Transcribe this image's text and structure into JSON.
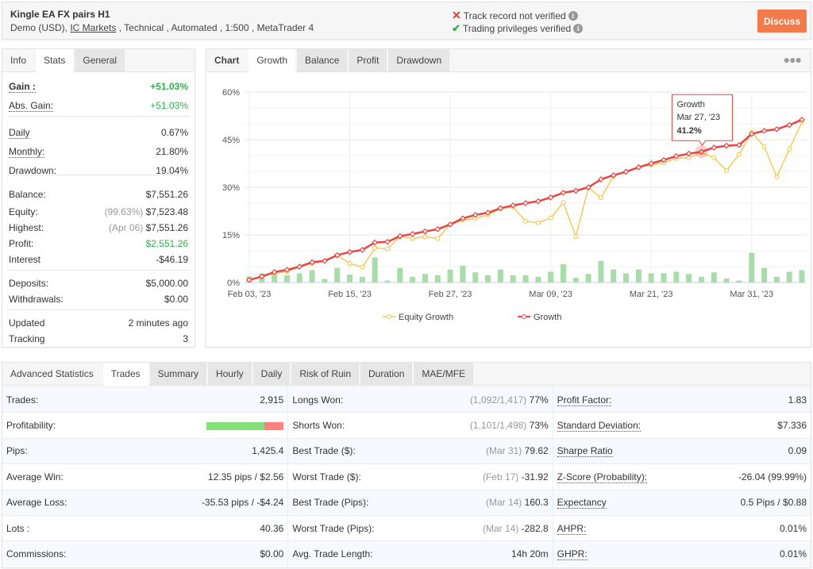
{
  "header": {
    "title": "Kingle EA FX pairs H1",
    "sub_prefix": "Demo (USD), ",
    "broker": "IC Markets",
    "sub_suffix": " , Technical , Automated , 1:500 , MetaTrader 4",
    "verify": [
      {
        "icon": "x-icon",
        "text": "Track record not verified",
        "color": "#e53935"
      },
      {
        "icon": "check-icon",
        "text": "Trading privileges verified",
        "color": "#2db24a"
      }
    ],
    "discuss": "Discuss"
  },
  "left": {
    "tabs": [
      "Info",
      "Stats",
      "General"
    ],
    "active": "Stats",
    "rows": [
      {
        "k": "Gain :",
        "v": "+51.03%",
        "style": "green bold"
      },
      {
        "k": "Abs. Gain:",
        "v": "+51.03%",
        "style": "green"
      },
      {
        "k": "Daily",
        "v": "0.67%"
      },
      {
        "k": "Monthly:",
        "v": "21.80%"
      },
      {
        "k": "Drawdown:",
        "v": "19.04%"
      },
      {
        "k": "Balance:",
        "v": "$7,551.26"
      },
      {
        "k": "Equity:",
        "pre": "(99.63%)",
        "v": "$7,523.48"
      },
      {
        "k": "Highest:",
        "pre": "(Apr 06)",
        "v": "$7,551.26"
      },
      {
        "k": "Profit:",
        "v": "$2,551.26",
        "style": "green"
      },
      {
        "k": "Interest",
        "v": "-$46.19"
      },
      {
        "k": "Deposits:",
        "v": "$5,000.00"
      },
      {
        "k": "Withdrawals:",
        "v": "$0.00"
      },
      {
        "k": "Updated",
        "v": "2 minutes ago"
      },
      {
        "k": "Tracking",
        "v": "3"
      }
    ]
  },
  "chart": {
    "tabs": [
      "Chart",
      "Growth",
      "Balance",
      "Profit",
      "Drawdown"
    ],
    "active": "Growth"
  },
  "chart_data": {
    "type": "line",
    "title": "",
    "xlabel": "",
    "ylabel": "",
    "ylim": [
      0,
      60
    ],
    "grid": true,
    "legend": "bottom",
    "y_ticks": [
      "0%",
      "15%",
      "30%",
      "45%",
      "60%"
    ],
    "x_ticks": [
      {
        "label": "Feb 03, '23",
        "index": 0
      },
      {
        "label": "Feb 15, '23",
        "index": 8
      },
      {
        "label": "Feb 27, '23",
        "index": 16
      },
      {
        "label": "Mar 09, '23",
        "index": 24
      },
      {
        "label": "Mar 21, '23",
        "index": 32
      },
      {
        "label": "Mar 31, '23",
        "index": 40
      }
    ],
    "series": [
      {
        "name": "Equity Growth",
        "color": "#f5c242",
        "values": [
          0.8,
          1.9,
          2.9,
          3.4,
          5.0,
          6.0,
          6.8,
          8.6,
          6.0,
          4.8,
          10.9,
          10.6,
          14.4,
          13.9,
          14.4,
          13.9,
          18.3,
          19.6,
          20.2,
          21.3,
          23.3,
          23.8,
          19.3,
          18.8,
          20.3,
          25.2,
          14.5,
          29.9,
          26.7,
          33.5,
          34.9,
          36.3,
          37.1,
          37.7,
          39.1,
          39.3,
          40.9,
          39.3,
          35.3,
          40.3,
          47.3,
          42.8,
          33.3,
          42.0,
          50.6
        ]
      },
      {
        "name": "Growth",
        "color": "#e84545",
        "values": [
          0.8,
          1.9,
          3.3,
          4.0,
          5.0,
          6.4,
          6.8,
          8.6,
          9.6,
          10.3,
          12.6,
          12.8,
          14.6,
          15.3,
          16.1,
          16.8,
          18.3,
          20.2,
          21.3,
          22.0,
          23.4,
          24.3,
          25.0,
          25.6,
          26.8,
          28.3,
          28.9,
          30.0,
          32.5,
          33.8,
          34.9,
          36.3,
          37.5,
          38.6,
          39.8,
          40.6,
          41.2,
          42.5,
          43.1,
          43.3,
          46.8,
          47.8,
          48.3,
          49.6,
          51.3
        ]
      }
    ],
    "bars": {
      "color": "#a8dca8",
      "values": [
        1.9,
        2.9,
        3.6,
        2.3,
        2.9,
        3.9,
        1.1,
        4.6,
        2.5,
        1.8,
        7.9,
        0.6,
        4.6,
        1.8,
        2.7,
        2.3,
        4.1,
        5.3,
        3.2,
        2.3,
        4.1,
        2.3,
        2.3,
        1.8,
        3.4,
        5.8,
        1.5,
        2.7,
        6.8,
        4.1,
        2.9,
        4.1,
        2.9,
        2.9,
        3.4,
        2.7,
        1.8,
        3.2,
        1.3,
        0.6,
        9.4,
        4.6,
        1.8,
        3.4,
        3.9
      ]
    },
    "tooltip": {
      "index": 36,
      "series": "Growth",
      "date": "Mar 27, '23",
      "value": "41.2%"
    }
  },
  "advanced": {
    "title": "Advanced Statistics",
    "tabs": [
      "Trades",
      "Summary",
      "Hourly",
      "Daily",
      "Risk of Ruin",
      "Duration",
      "MAE/MFE"
    ],
    "active": "Trades",
    "profitability": {
      "win_pct": 75,
      "win_color": "#86e07a",
      "loss_color": "#ff8080"
    },
    "rows": [
      [
        {
          "k": "Trades:",
          "v": "2,915"
        },
        {
          "k": "Longs Won:",
          "pre": "(1,092/1,417)",
          "v": "77%"
        },
        {
          "k": "Profit Factor:",
          "v": "1.83",
          "dotted": true
        }
      ],
      [
        {
          "k": "Profitability:",
          "v": ""
        },
        {
          "k": "Shorts Won:",
          "pre": "(1,101/1,498)",
          "v": "73%"
        },
        {
          "k": "Standard Deviation:",
          "v": "$7.336",
          "dotted": true
        }
      ],
      [
        {
          "k": "Pips:",
          "v": "1,425.4"
        },
        {
          "k": "Best Trade ($):",
          "pre": "(Mar 31)",
          "v": "79.62"
        },
        {
          "k": "Sharpe Ratio",
          "v": "0.09",
          "dotted": true
        }
      ],
      [
        {
          "k": "Average Win:",
          "v": "12.35 pips / $2.56"
        },
        {
          "k": "Worst Trade ($):",
          "pre": "(Feb 17)",
          "v": "-31.92"
        },
        {
          "k": "Z-Score (Probability):",
          "v": "-26.04 (99.99%)",
          "dotted": true
        }
      ],
      [
        {
          "k": "Average Loss:",
          "v": "-35.53 pips / -$4.24"
        },
        {
          "k": "Best Trade (Pips):",
          "pre": "(Mar 14)",
          "v": "160.3"
        },
        {
          "k": "Expectancy",
          "v": "0.5 Pips / $0.88",
          "dotted": true
        }
      ],
      [
        {
          "k": "Lots :",
          "v": "40.36"
        },
        {
          "k": "Worst Trade (Pips):",
          "pre": "(Mar 14)",
          "v": "-282.8"
        },
        {
          "k": "AHPR:",
          "v": "0.01%",
          "dotted": true
        }
      ],
      [
        {
          "k": "Commissions:",
          "v": "$0.00"
        },
        {
          "k": "Avg. Trade Length:",
          "v": "14h 20m"
        },
        {
          "k": "GHPR:",
          "v": "0.01%",
          "dotted": true
        }
      ]
    ]
  }
}
